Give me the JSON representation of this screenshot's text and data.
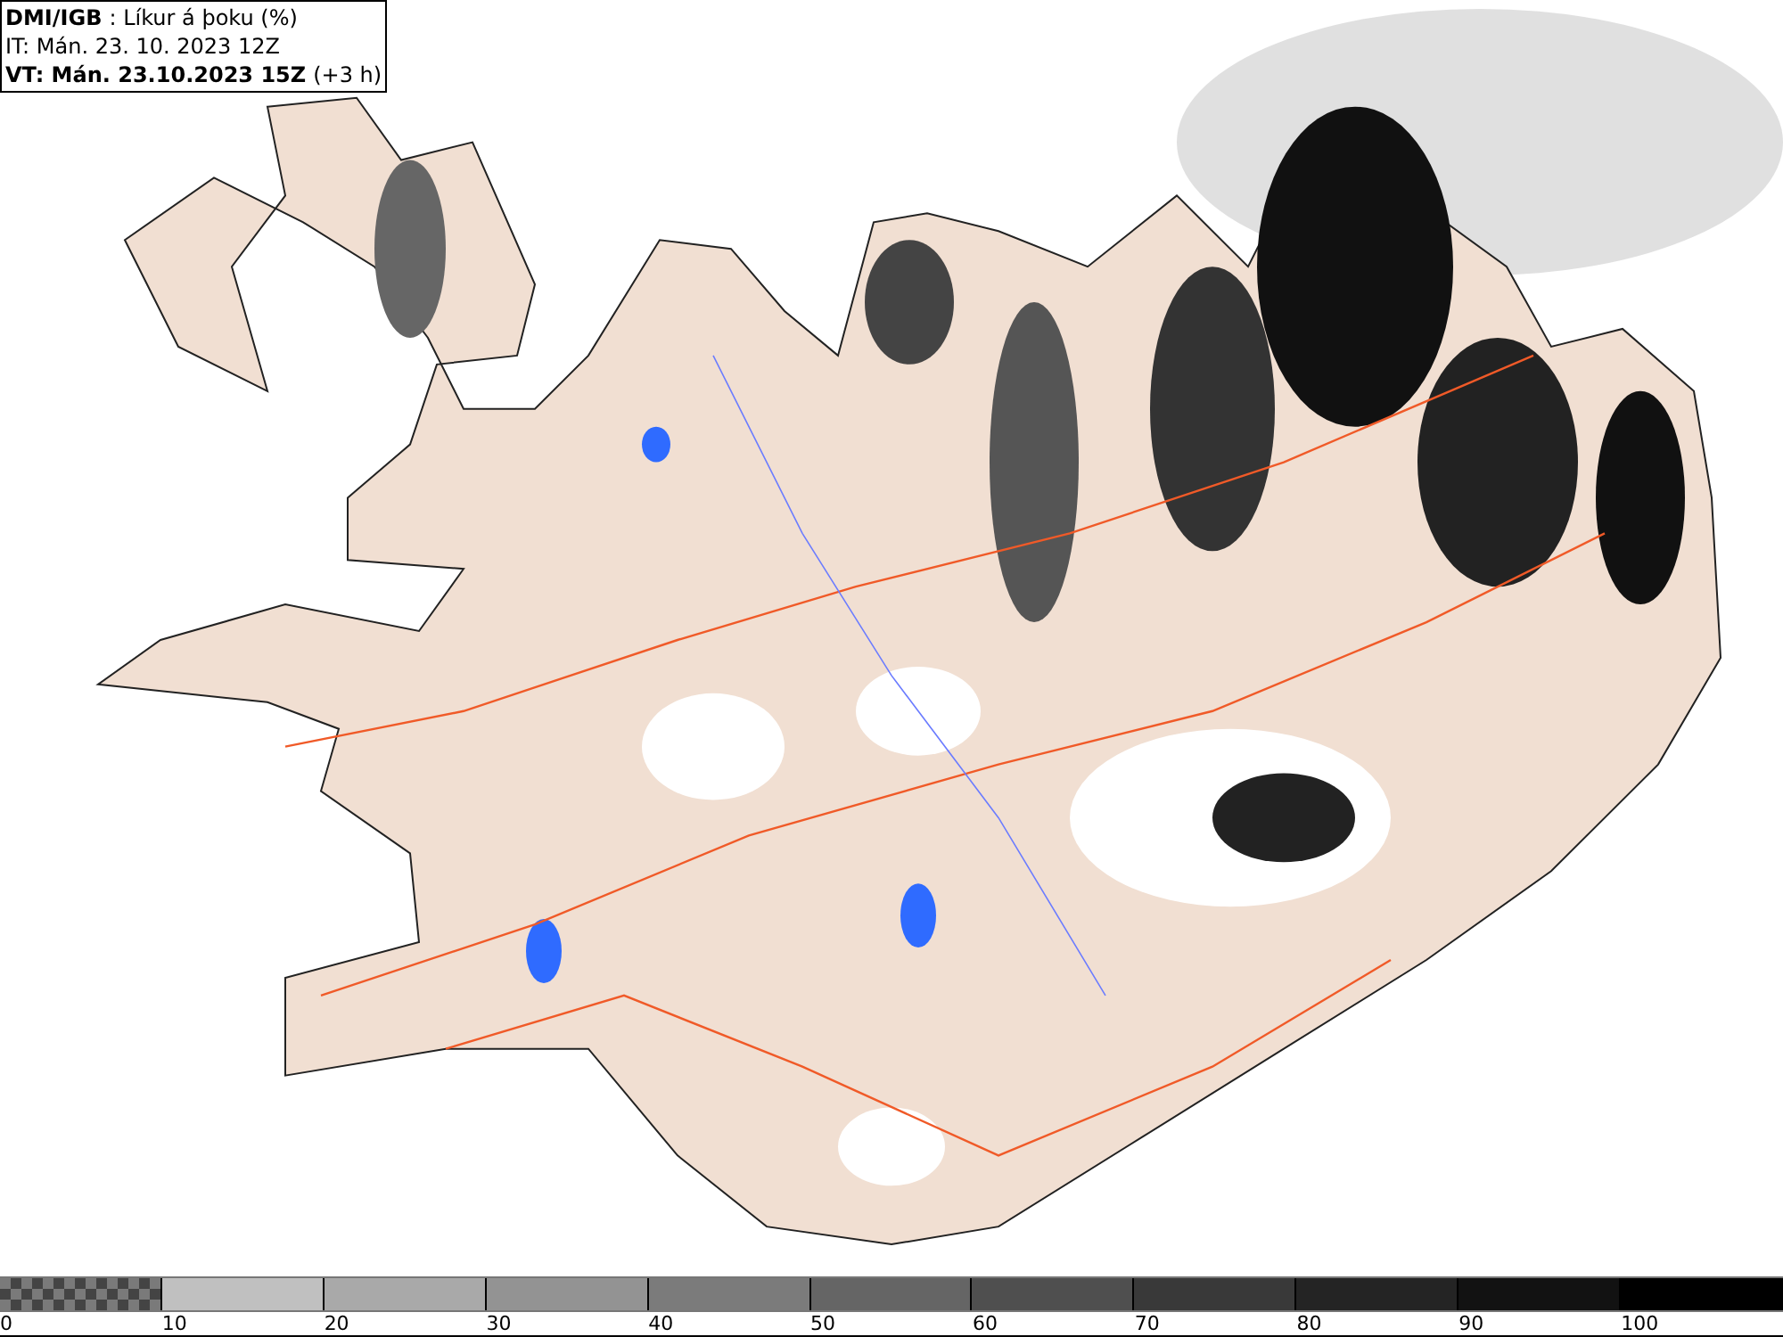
{
  "header": {
    "source": "DMI/IGB",
    "title": ": Líkur á þoku (%)",
    "issued": "IT: Mán. 23. 10. 2023 12Z",
    "valid": "VT: Mán. 23.10.2023 15Z",
    "offset": "(+3 h)"
  },
  "legend": {
    "segments": [
      {
        "kind": "checker",
        "color": "#7a7a7a",
        "label": "0"
      },
      {
        "kind": "solid",
        "color": "#c0c0c0",
        "label": "10"
      },
      {
        "kind": "solid",
        "color": "#a9a9a9",
        "label": "20"
      },
      {
        "kind": "solid",
        "color": "#939393",
        "label": "30"
      },
      {
        "kind": "solid",
        "color": "#7b7b7b",
        "label": "40"
      },
      {
        "kind": "solid",
        "color": "#656565",
        "label": "50"
      },
      {
        "kind": "solid",
        "color": "#4f4f4f",
        "label": "60"
      },
      {
        "kind": "solid",
        "color": "#393939",
        "label": "70"
      },
      {
        "kind": "solid",
        "color": "#242424",
        "label": "80"
      },
      {
        "kind": "solid",
        "color": "#121212",
        "label": "90"
      },
      {
        "kind": "solid",
        "color": "#000000",
        "label": "100"
      }
    ]
  }
}
